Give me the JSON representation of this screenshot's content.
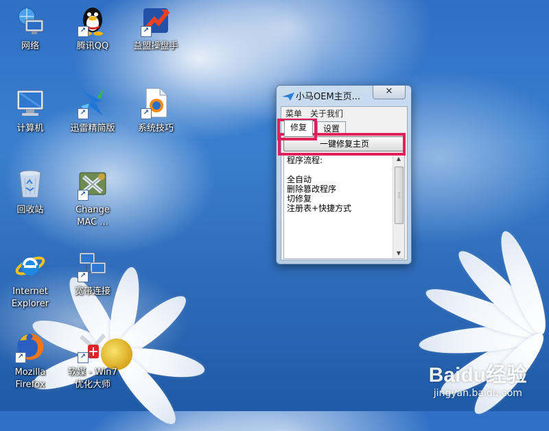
{
  "desktop": {
    "icons": [
      {
        "label": "网络",
        "icon": "network-icon",
        "shortcut": false
      },
      {
        "label": "腾讯QQ",
        "icon": "qq-penguin-icon",
        "shortcut": true
      },
      {
        "label": "益盟操盘手",
        "icon": "stock-app-icon",
        "shortcut": true
      },
      {
        "label": "计算机",
        "icon": "computer-icon",
        "shortcut": false
      },
      {
        "label": "迅雷精简版",
        "icon": "thunder-icon",
        "shortcut": true
      },
      {
        "label": "系统技巧",
        "icon": "firefox-document-icon",
        "shortcut": true
      },
      {
        "label": "回收站",
        "icon": "recycle-bin-icon",
        "shortcut": false
      },
      {
        "label": "Change\nMAC ...",
        "icon": "change-mac-icon",
        "shortcut": true
      },
      {
        "label": "Internet\nExplorer",
        "icon": "internet-explorer-icon",
        "shortcut": false
      },
      {
        "label": "宽带连接",
        "icon": "broadband-icon",
        "shortcut": true
      },
      {
        "label": "Mozilla\nFirefox",
        "icon": "firefox-icon",
        "shortcut": true
      },
      {
        "label": "软媒 - Win7\n优化大师",
        "icon": "win7-optimizer-icon",
        "shortcut": true
      }
    ]
  },
  "window": {
    "title": "小马OEM主页...",
    "close_label": "✕",
    "menu": [
      "菜单",
      "关于我们"
    ],
    "tabs": [
      "修复",
      "设置"
    ],
    "active_tab": "修复",
    "repair_button_label": "一键修复主页",
    "text_content": "程序流程:\n\n全自动\n删除篡改程序\n切修复\n注册表+快捷方式"
  },
  "colors": {
    "highlight": "#e0205a",
    "sky": "#2f6fc4"
  },
  "watermark": {
    "logo": "Baidu经验",
    "url": "jingyan.baidu.com"
  }
}
